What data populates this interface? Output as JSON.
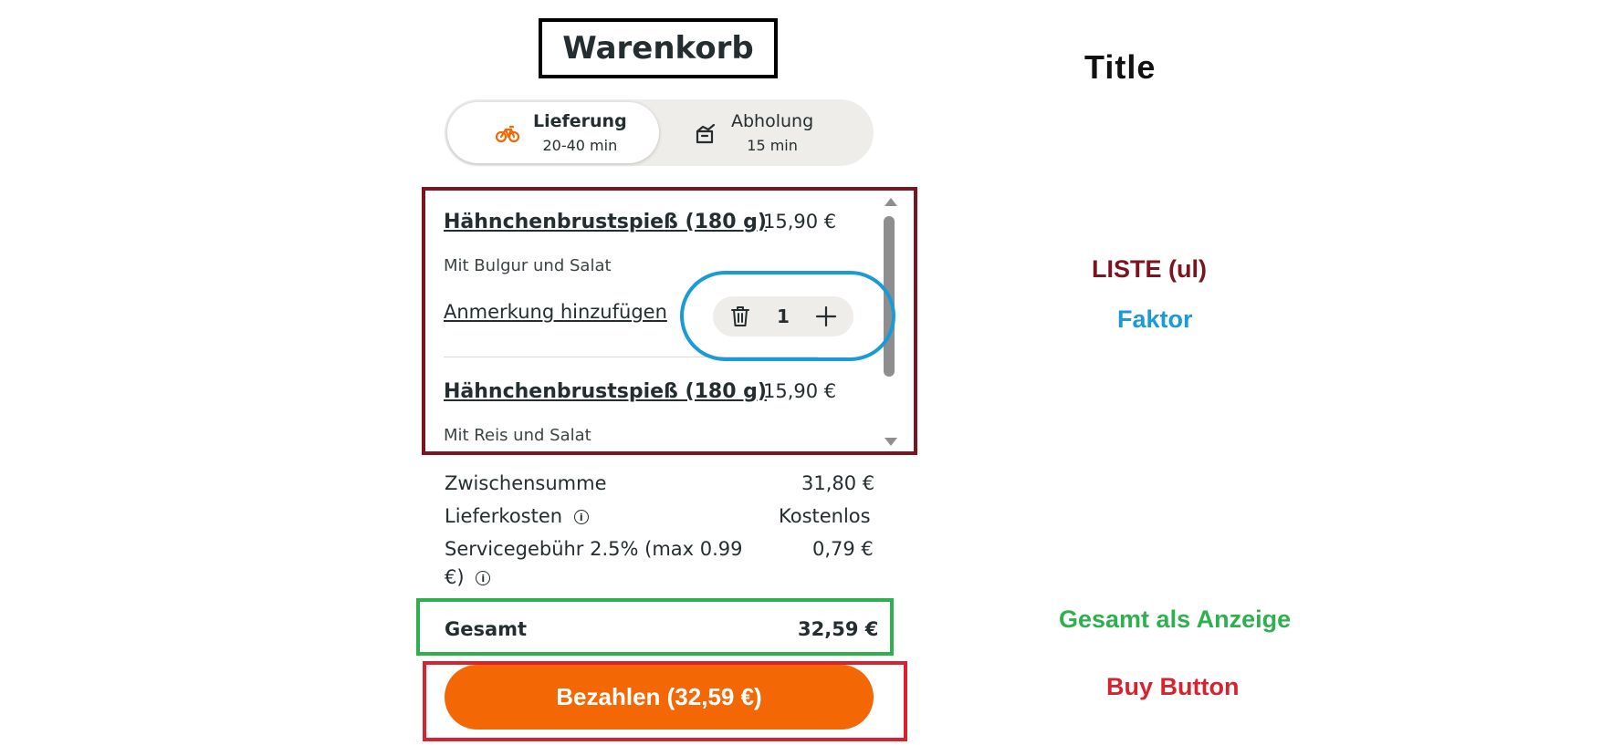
{
  "header": {
    "title": "Warenkorb"
  },
  "delivery_toggle": {
    "options": [
      {
        "label": "Lieferung",
        "sub": "20-40 min",
        "icon": "bike-icon",
        "active": true
      },
      {
        "label": "Abholung",
        "sub": "15 min",
        "icon": "pickup-bag-icon",
        "active": false
      }
    ]
  },
  "cart": {
    "items": [
      {
        "name": "Hähnchenbrustspieß (180 g)",
        "price": "15,90 €",
        "description": "Mit Bulgur und Salat",
        "note_link": "Anmerkung hinzufügen",
        "quantity": "1"
      },
      {
        "name": "Hähnchenbrustspieß (180 g)",
        "price": "15,90 €",
        "description": "Mit Reis und Salat"
      }
    ]
  },
  "summary": {
    "subtotal_label": "Zwischensumme",
    "subtotal_value": "31,80 €",
    "delivery_label": "Lieferkosten",
    "delivery_value": "Kostenlos",
    "service_label_line1": "Servicegebühr 2.5% (max 0.99",
    "service_label_line2": "€)",
    "service_value": "0,79 €",
    "total_label": "Gesamt",
    "total_value": "32,59 €"
  },
  "buy_button": {
    "label": "Bezahlen (32,59 €)"
  },
  "annotations": {
    "title": "Title",
    "liste": "LISTE (ul)",
    "faktor": "Faktor",
    "gesamt": "Gesamt als Anzeige",
    "buy": "Buy Button"
  },
  "colors": {
    "accent_orange": "#f36805",
    "list_border": "#7b1320",
    "faktor_border": "#1a9bd7",
    "total_border": "#2fb04f",
    "buy_border": "#d7232f"
  }
}
